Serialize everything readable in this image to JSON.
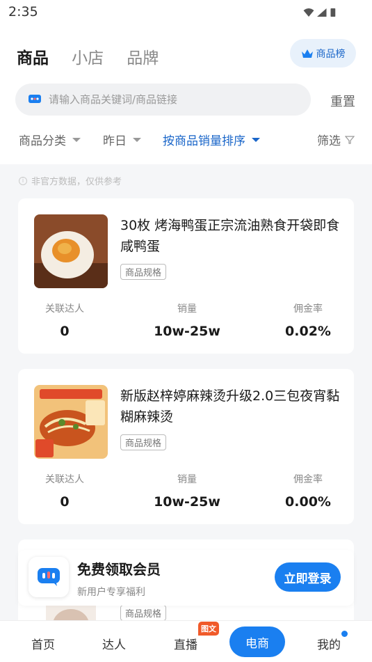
{
  "status_bar": {
    "time": "2:35"
  },
  "header": {
    "tabs": [
      {
        "label": "商品",
        "active": true
      },
      {
        "label": "小店",
        "active": false
      },
      {
        "label": "品牌",
        "active": false
      }
    ],
    "rank_button": "商品榜"
  },
  "search": {
    "placeholder": "请输入商品关键词/商品链接",
    "reset_label": "重置"
  },
  "filters": {
    "category": "商品分类",
    "date": "昨日",
    "sort": "按商品销量排序",
    "screen": "筛选"
  },
  "notice": "非官方数据，仅供参考",
  "products": [
    {
      "title": "30枚 烤海鸭蛋正宗流油熟食开袋即食咸鸭蛋",
      "spec_label": "商品规格",
      "stats": [
        {
          "label": "关联达人",
          "value": "0"
        },
        {
          "label": "销量",
          "value": "10w-25w"
        },
        {
          "label": "佣金率",
          "value": "0.02%"
        }
      ]
    },
    {
      "title": "新版赵梓婷麻辣烫升级2.0三包夜宵黏糊麻辣烫",
      "spec_label": "商品规格",
      "stats": [
        {
          "label": "关联达人",
          "value": "0"
        },
        {
          "label": "销量",
          "value": "10w-25w"
        },
        {
          "label": "佣金率",
          "value": "0.00%"
        }
      ]
    }
  ],
  "partial_product": {
    "spec_label": "商品规格"
  },
  "member_banner": {
    "title": "免费领取会员",
    "subtitle": "新用户专享福利",
    "button": "立即登录"
  },
  "tabbar": {
    "items": [
      "首页",
      "达人",
      "直播",
      "电商",
      "我的"
    ],
    "badge": "图文",
    "active_index": 3
  },
  "colors": {
    "accent": "#1a7ff0",
    "badge": "#f05a2a"
  }
}
